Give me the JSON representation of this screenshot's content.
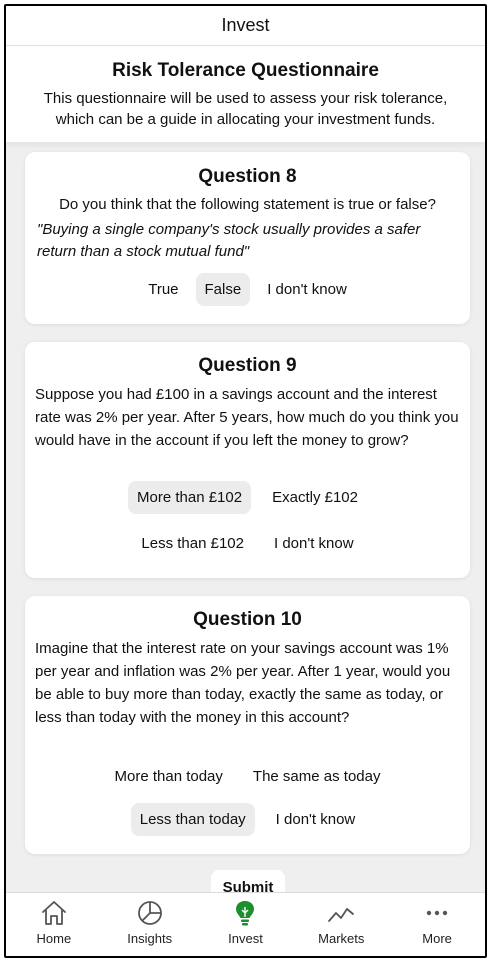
{
  "header": {
    "title": "Invest"
  },
  "intro": {
    "title": "Risk Tolerance Questionnaire",
    "line1": "This questionnaire will be used to assess your risk tolerance,",
    "line2": "which can be a guide in allocating your investment funds."
  },
  "q8": {
    "title": "Question 8",
    "text": "Do you think that the following statement is true or false?",
    "quote": "\"Buying a single company's stock usually provides a safer return than a stock mutual fund\"",
    "options": [
      "True",
      "False",
      "I don't know"
    ],
    "selected": "False"
  },
  "q9": {
    "title": "Question 9",
    "text": "Suppose you had £100 in a savings account and the interest rate was 2% per year. After 5 years, how much do you think you would have in the account if you left the money to grow?",
    "options": [
      "More than £102",
      "Exactly £102",
      "Less than £102",
      "I don't know"
    ],
    "selected": "More than £102"
  },
  "q10": {
    "title": "Question 10",
    "text": "Imagine that the interest rate on your savings account was 1% per year and inflation was 2% per year. After 1 year, would you be able to buy more than today, exactly the same as today, or less than today with the money in this account?",
    "options": [
      "More than today",
      "The same as today",
      "Less than today",
      "I don't know"
    ],
    "selected": "Less than today"
  },
  "submit_label": "Submit",
  "tabs": [
    {
      "label": "Home",
      "icon": "home-icon"
    },
    {
      "label": "Insights",
      "icon": "pie-chart-icon"
    },
    {
      "label": "Invest",
      "icon": "lightbulb-icon",
      "active": true,
      "color": "#1e8f2e"
    },
    {
      "label": "Markets",
      "icon": "trend-line-icon"
    },
    {
      "label": "More",
      "icon": "more-dots-icon"
    }
  ]
}
